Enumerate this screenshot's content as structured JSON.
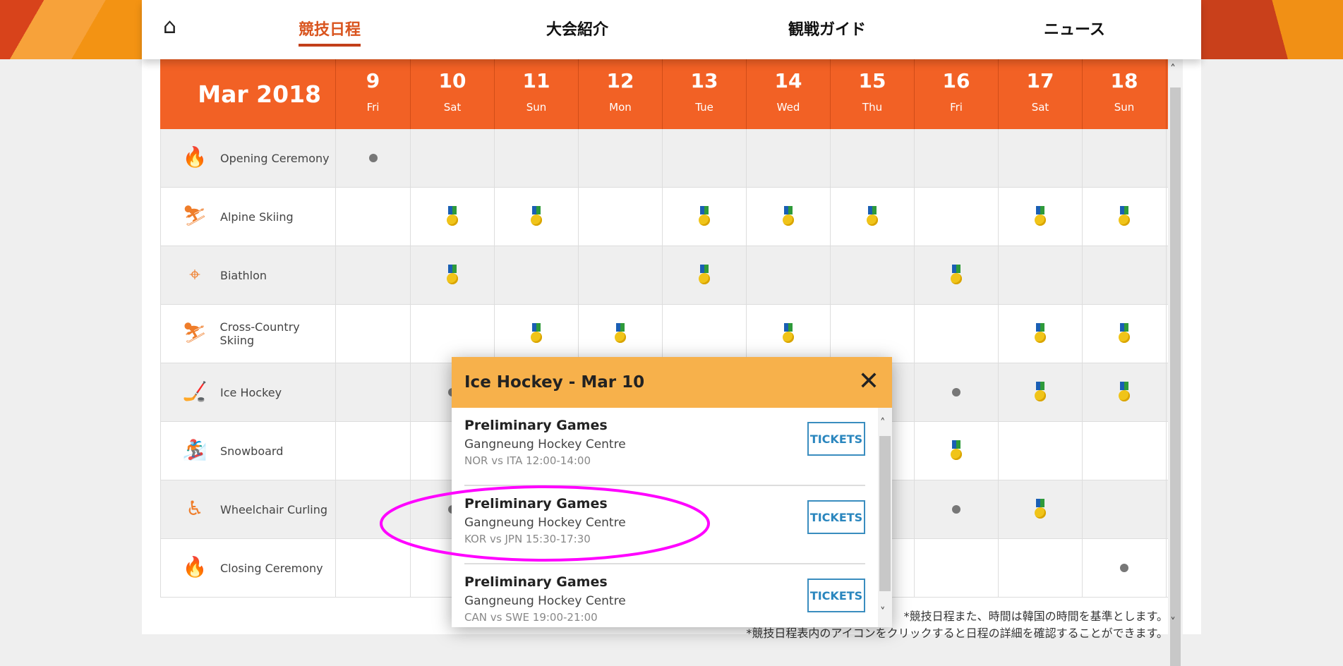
{
  "nav": {
    "home_icon": "home-icon",
    "items": [
      {
        "label": "競技日程",
        "active": true
      },
      {
        "label": "大会紹介"
      },
      {
        "label": "観戦ガイド"
      },
      {
        "label": "ニュース"
      }
    ]
  },
  "schedule": {
    "month": "Mar 2018",
    "days": [
      {
        "n": "9",
        "w": "Fri"
      },
      {
        "n": "10",
        "w": "Sat"
      },
      {
        "n": "11",
        "w": "Sun"
      },
      {
        "n": "12",
        "w": "Mon"
      },
      {
        "n": "13",
        "w": "Tue"
      },
      {
        "n": "14",
        "w": "Wed"
      },
      {
        "n": "15",
        "w": "Thu"
      },
      {
        "n": "16",
        "w": "Fri"
      },
      {
        "n": "17",
        "w": "Sat"
      },
      {
        "n": "18",
        "w": "Sun"
      }
    ],
    "sports": [
      {
        "name": "Opening Ceremony",
        "icon": "torch-icon",
        "events": {
          "9": "dot"
        }
      },
      {
        "name": "Alpine Skiing",
        "icon": "alpine-skiing-icon",
        "events": {
          "10": "medal",
          "11": "medal",
          "13": "medal",
          "14": "medal",
          "15": "medal",
          "17": "medal",
          "18": "medal"
        }
      },
      {
        "name": "Biathlon",
        "icon": "biathlon-icon",
        "events": {
          "10": "medal",
          "13": "medal",
          "16": "medal"
        }
      },
      {
        "name": "Cross-Country Skiing",
        "icon": "cross-country-skiing-icon",
        "events": {
          "11": "medal",
          "12": "medal",
          "14": "medal",
          "17": "medal",
          "18": "medal"
        }
      },
      {
        "name": "Ice Hockey",
        "icon": "ice-hockey-icon",
        "events": {
          "10": "dot",
          "16": "dot",
          "17": "medal",
          "18": "medal"
        }
      },
      {
        "name": "Snowboard",
        "icon": "snowboard-icon",
        "events": {
          "16": "medal"
        }
      },
      {
        "name": "Wheelchair Curling",
        "icon": "wheelchair-curling-icon",
        "events": {
          "10": "dot",
          "16": "dot",
          "17": "medal"
        }
      },
      {
        "name": "Closing Ceremony",
        "icon": "torch-icon",
        "events": {
          "18": "dot"
        }
      }
    ]
  },
  "notes": [
    "*競技日程また、時間は韓国の時間を基準とします。",
    "*競技日程表内のアイコンをクリックすると日程の詳細を確認することができます。"
  ],
  "popup": {
    "title": "Ice Hockey - Mar 10",
    "games": [
      {
        "title": "Preliminary Games",
        "venue": "Gangneung Hockey Centre",
        "match": "NOR vs ITA 12:00-14:00",
        "button": "TICKETS"
      },
      {
        "title": "Preliminary Games",
        "venue": "Gangneung Hockey Centre",
        "match": "KOR vs JPN 15:30-17:30",
        "button": "TICKETS",
        "highlighted": true
      },
      {
        "title": "Preliminary Games",
        "venue": "Gangneung Hockey Centre",
        "match": "CAN vs SWE 19:00-21:00",
        "button": "TICKETS"
      }
    ]
  },
  "colors": {
    "header": "#f26125",
    "popup_header": "#f7b14b",
    "accent": "#d9541e",
    "tickets": "#2a86be",
    "highlight": "#ff00ff"
  }
}
